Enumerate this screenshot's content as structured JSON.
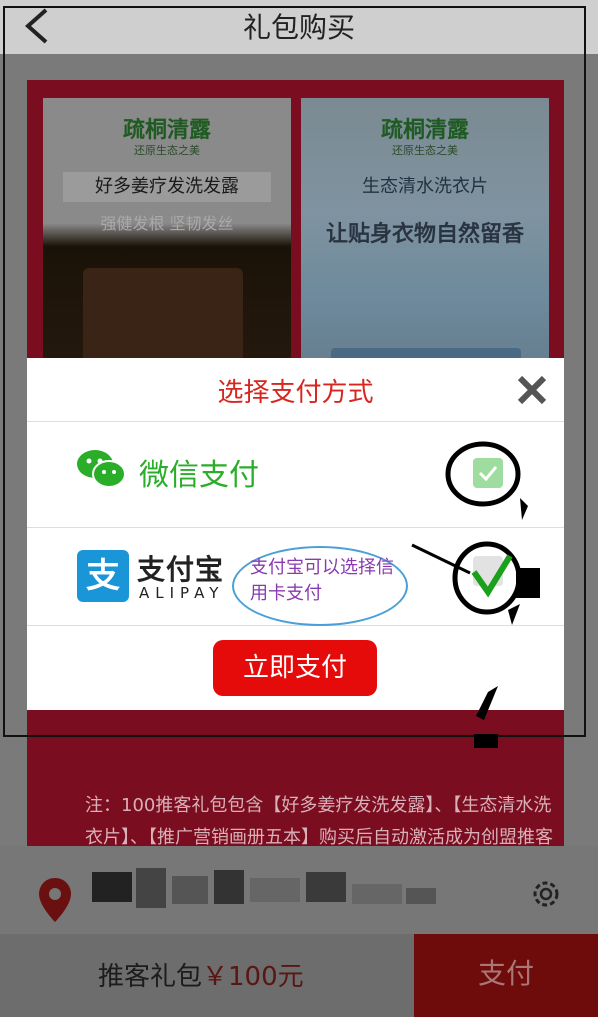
{
  "header": {
    "title": "礼包购买",
    "back_icon": "chevron-left-icon"
  },
  "products": [
    {
      "brand": "疏桐清露",
      "brand_sub": "还原生态之美",
      "name": "好多姜疗发洗发露",
      "tagline": "强健发根 坚韧发丝"
    },
    {
      "brand": "疏桐清露",
      "brand_sub": "还原生态之美",
      "name": "生态清水洗衣片",
      "tagline": "让贴身衣物自然留香"
    }
  ],
  "note": "注：100推客礼包包含【好多姜疗发洗发露】、【生态清水洗衣片】、【推广营销画册五本】购买后自动激活成为创盟推客",
  "address": {
    "icon": "location-pin-icon",
    "settings_icon": "gear-icon"
  },
  "bottom_bar": {
    "label": "推客礼包",
    "price": "￥100元",
    "pay_label": "支付"
  },
  "modal": {
    "title": "选择支付方式",
    "close_icon": "close-icon",
    "options": [
      {
        "name": "微信支付",
        "icon": "wechat-icon",
        "checked": true
      },
      {
        "name": "支付宝",
        "sub": "ALIPAY",
        "icon": "alipay-icon",
        "checked": true
      }
    ],
    "pay_button": "立即支付"
  },
  "annotation": {
    "text": "支付宝可以选择信用卡支付"
  },
  "colors": {
    "accent_red": "#e60b0b",
    "wechat_green": "#2aae2a",
    "alipay_blue": "#1a96d8"
  }
}
